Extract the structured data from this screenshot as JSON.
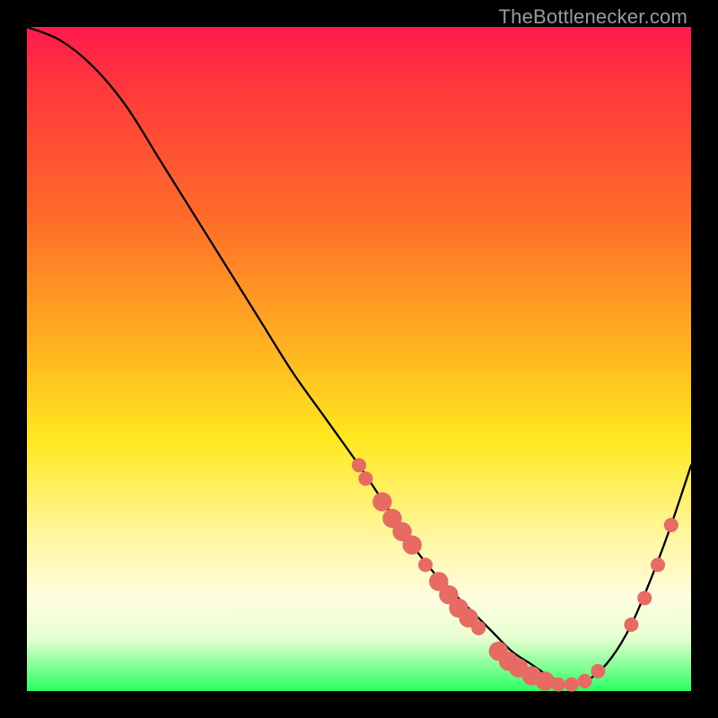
{
  "watermark": "TheBottlenecker.com",
  "colors": {
    "gradient_top": "#ff1a4d",
    "gradient_bottom": "#2bff63",
    "curve": "#000000",
    "marker": "#e86b63",
    "frame_bg": "#000000"
  },
  "chart_data": {
    "type": "line",
    "title": "",
    "xlabel": "",
    "ylabel": "",
    "xlim": [
      0,
      100
    ],
    "ylim": [
      0,
      100
    ],
    "x": [
      0,
      5,
      10,
      15,
      20,
      25,
      30,
      35,
      40,
      45,
      50,
      54,
      58,
      62,
      66,
      70,
      73,
      76,
      79,
      82,
      85,
      88,
      91,
      94,
      97,
      100
    ],
    "y": [
      100,
      98,
      94,
      88,
      80,
      72,
      64,
      56,
      48,
      41,
      34,
      28,
      22,
      17,
      13,
      9,
      6,
      4,
      2,
      1,
      2,
      5,
      10,
      17,
      25,
      34
    ],
    "markers": [
      {
        "x": 50,
        "y": 34,
        "r": 1.2
      },
      {
        "x": 51,
        "y": 32,
        "r": 1.2
      },
      {
        "x": 53.5,
        "y": 28.5,
        "r": 1.6
      },
      {
        "x": 55,
        "y": 26,
        "r": 1.6
      },
      {
        "x": 56.5,
        "y": 24,
        "r": 1.6
      },
      {
        "x": 58,
        "y": 22,
        "r": 1.6
      },
      {
        "x": 60,
        "y": 19,
        "r": 1.2
      },
      {
        "x": 62,
        "y": 16.5,
        "r": 1.6
      },
      {
        "x": 63.5,
        "y": 14.5,
        "r": 1.6
      },
      {
        "x": 65,
        "y": 12.5,
        "r": 1.6
      },
      {
        "x": 66.5,
        "y": 11,
        "r": 1.6
      },
      {
        "x": 68,
        "y": 9.5,
        "r": 1.2
      },
      {
        "x": 71,
        "y": 6,
        "r": 1.6
      },
      {
        "x": 72.5,
        "y": 4.5,
        "r": 1.6
      },
      {
        "x": 74,
        "y": 3.5,
        "r": 1.6
      },
      {
        "x": 76,
        "y": 2.3,
        "r": 1.6
      },
      {
        "x": 78,
        "y": 1.5,
        "r": 1.6
      },
      {
        "x": 80,
        "y": 1,
        "r": 1.2
      },
      {
        "x": 82,
        "y": 1,
        "r": 1.2
      },
      {
        "x": 84,
        "y": 1.5,
        "r": 1.2
      },
      {
        "x": 86,
        "y": 3,
        "r": 1.2
      },
      {
        "x": 91,
        "y": 10,
        "r": 1.2
      },
      {
        "x": 93,
        "y": 14,
        "r": 1.2
      },
      {
        "x": 95,
        "y": 19,
        "r": 1.2
      },
      {
        "x": 97,
        "y": 25,
        "r": 1.2
      }
    ]
  }
}
